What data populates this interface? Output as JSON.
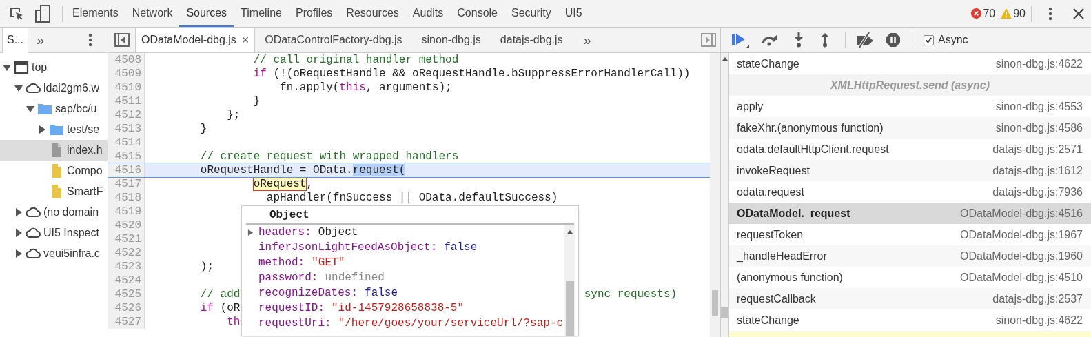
{
  "main_tabs": [
    {
      "label": "Elements",
      "selected": false
    },
    {
      "label": "Network",
      "selected": false
    },
    {
      "label": "Sources",
      "selected": true
    },
    {
      "label": "Timeline",
      "selected": false
    },
    {
      "label": "Profiles",
      "selected": false
    },
    {
      "label": "Resources",
      "selected": false
    },
    {
      "label": "Audits",
      "selected": false
    },
    {
      "label": "Console",
      "selected": false
    },
    {
      "label": "Security",
      "selected": false
    },
    {
      "label": "UI5",
      "selected": false
    }
  ],
  "counters": {
    "errors": "70",
    "warnings": "90"
  },
  "navigator": {
    "tab": "S...",
    "more": "»",
    "tree": [
      {
        "label": "top",
        "kind": "frame",
        "expanded": true,
        "selected": false,
        "children": [
          {
            "label": "ldai2gm6.w",
            "kind": "cloud",
            "expanded": true,
            "selected": false,
            "children": [
              {
                "label": "sap/bc/u",
                "kind": "folder",
                "expanded": true,
                "selected": false,
                "children": [
                  {
                    "label": "test/se",
                    "kind": "folder",
                    "expanded": false,
                    "selected": false
                  },
                  {
                    "label": "index.h",
                    "kind": "file-gray",
                    "selected": true
                  },
                  {
                    "label": "Compo",
                    "kind": "file-yellow",
                    "selected": false
                  },
                  {
                    "label": "SmartF",
                    "kind": "file-yellow",
                    "selected": false
                  }
                ]
              }
            ]
          },
          {
            "label": "(no domain",
            "kind": "cloud",
            "expanded": false,
            "selected": false
          },
          {
            "label": "UI5 Inspect",
            "kind": "cloud",
            "expanded": false,
            "selected": false
          },
          {
            "label": "veui5infra.c",
            "kind": "cloud",
            "expanded": false,
            "selected": false
          }
        ]
      }
    ]
  },
  "editor_tabs": [
    {
      "label": "ODataModel-dbg.js",
      "selected": true,
      "close": "×"
    },
    {
      "label": "ODataControlFactory-dbg.js",
      "selected": false
    },
    {
      "label": "sinon-dbg.js",
      "selected": false
    },
    {
      "label": "datajs-dbg.js",
      "selected": false
    }
  ],
  "editor_more": "»",
  "code": {
    "lines": [
      {
        "number": "4508",
        "current": false,
        "tokens": [
          {
            "text": "                // call original handler method",
            "kind": "comment"
          }
        ]
      },
      {
        "number": "4509",
        "current": false,
        "tokens": [
          {
            "text": "                if",
            "kind": "keyword"
          },
          {
            "text": " (!(oRequestHandle && oRequestHandle.bSuppressErrorHandlerCall))",
            "kind": "plain"
          }
        ]
      },
      {
        "number": "4510",
        "current": false,
        "tokens": [
          {
            "text": "                    fn.apply(",
            "kind": "plain"
          },
          {
            "text": "this",
            "kind": "keyword"
          },
          {
            "text": ", arguments);",
            "kind": "plain"
          }
        ]
      },
      {
        "number": "4511",
        "current": false,
        "tokens": [
          {
            "text": "                }",
            "kind": "plain"
          }
        ]
      },
      {
        "number": "4512",
        "current": false,
        "tokens": [
          {
            "text": "            };",
            "kind": "plain"
          }
        ]
      },
      {
        "number": "4513",
        "current": false,
        "tokens": [
          {
            "text": "        }",
            "kind": "plain"
          }
        ]
      },
      {
        "number": "4514",
        "current": false
      },
      {
        "number": "4515",
        "current": false,
        "tokens": [
          {
            "text": "        // create request with wrapped handlers",
            "kind": "comment"
          }
        ]
      },
      {
        "number": "4516",
        "current": true,
        "tokens": [
          {
            "text": "        oRequestHandle = OData.",
            "kind": "plain"
          },
          {
            "text": "request(",
            "kind": "selection"
          }
        ]
      },
      {
        "number": "4517",
        "current": false,
        "tokens": [
          {
            "text": "                oRequest",
            "kind": "hover"
          },
          {
            "text": ",",
            "kind": "plain"
          }
        ]
      },
      {
        "number": "4518",
        "current": false,
        "tokens": [
          {
            "text": "                  apHandler(fnSuccess || OData.defaultSuccess)",
            "kind": "plain"
          }
        ]
      },
      {
        "number": "4519",
        "current": false
      },
      {
        "number": "4520",
        "current": false
      },
      {
        "number": "4521",
        "current": false
      },
      {
        "number": "4522",
        "current": false
      },
      {
        "number": "4523",
        "current": false,
        "tokens": [
          {
            "text": "        );",
            "kind": "plain"
          }
        ]
      },
      {
        "number": "4524",
        "current": false
      },
      {
        "number": "4525",
        "current": false,
        "tokens": [
          {
            "text": "        // add",
            "kind": "comment"
          },
          {
            "text": "                                                    sync requests)",
            "kind": "comment"
          }
        ]
      },
      {
        "number": "4526",
        "current": false,
        "tokens": [
          {
            "text": "        if",
            "kind": "keyword"
          },
          {
            "text": " (oR",
            "kind": "plain"
          }
        ]
      },
      {
        "number": "4527",
        "current": false,
        "tokens": [
          {
            "text": "            th",
            "kind": "keyword"
          }
        ]
      }
    ]
  },
  "popover": {
    "title": "Object",
    "properties": [
      {
        "name": "headers:",
        "value": "Object",
        "kind": "object",
        "expandable": true
      },
      {
        "name": "inferJsonLightFeedAsObject:",
        "value": "false",
        "kind": "boolean",
        "expandable": false
      },
      {
        "name": "method:",
        "value": "\"GET\"",
        "kind": "string",
        "expandable": false
      },
      {
        "name": "password:",
        "value": "undefined",
        "kind": "undefined",
        "expandable": false
      },
      {
        "name": "recognizeDates:",
        "value": "false",
        "kind": "boolean",
        "expandable": false
      },
      {
        "name": "requestID:",
        "value": "\"id-1457928658838-5\"",
        "kind": "string",
        "expandable": false
      },
      {
        "name": "requestUri:",
        "value": "\"/here/goes/your/serviceUrl/?sap-c",
        "kind": "string",
        "expandable": false
      }
    ]
  },
  "debugger": {
    "async": {
      "label": "Async",
      "checked": true
    }
  },
  "call_stack": [
    {
      "kind": "frame",
      "name": "stateChange",
      "location": "sinon-dbg.js:4622",
      "selected": false
    },
    {
      "kind": "async",
      "name": "XMLHttpRequest.send (async)"
    },
    {
      "kind": "frame",
      "name": "apply",
      "location": "sinon-dbg.js:4553",
      "selected": false
    },
    {
      "kind": "frame",
      "name": "fakeXhr.(anonymous function)",
      "location": "sinon-dbg.js:4586",
      "selected": false
    },
    {
      "kind": "frame",
      "name": "odata.defaultHttpClient.request",
      "location": "datajs-dbg.js:2571",
      "selected": false
    },
    {
      "kind": "frame",
      "name": "invokeRequest",
      "location": "datajs-dbg.js:1612",
      "selected": false
    },
    {
      "kind": "frame",
      "name": "odata.request",
      "location": "datajs-dbg.js:7936",
      "selected": false
    },
    {
      "kind": "frame",
      "name": "ODataModel._request",
      "location": "ODataModel-dbg.js:4516",
      "selected": true
    },
    {
      "kind": "frame",
      "name": "requestToken",
      "location": "ODataModel-dbg.js:1967",
      "selected": false
    },
    {
      "kind": "frame",
      "name": "_handleHeadError",
      "location": "ODataModel-dbg.js:1960",
      "selected": false
    },
    {
      "kind": "frame",
      "name": "(anonymous function)",
      "location": "ODataModel-dbg.js:4510",
      "selected": false
    },
    {
      "kind": "frame",
      "name": "requestCallback",
      "location": "datajs-dbg.js:2537",
      "selected": false
    },
    {
      "kind": "frame",
      "name": "stateChange",
      "location": "sinon-dbg.js:4622",
      "selected": false
    }
  ]
}
